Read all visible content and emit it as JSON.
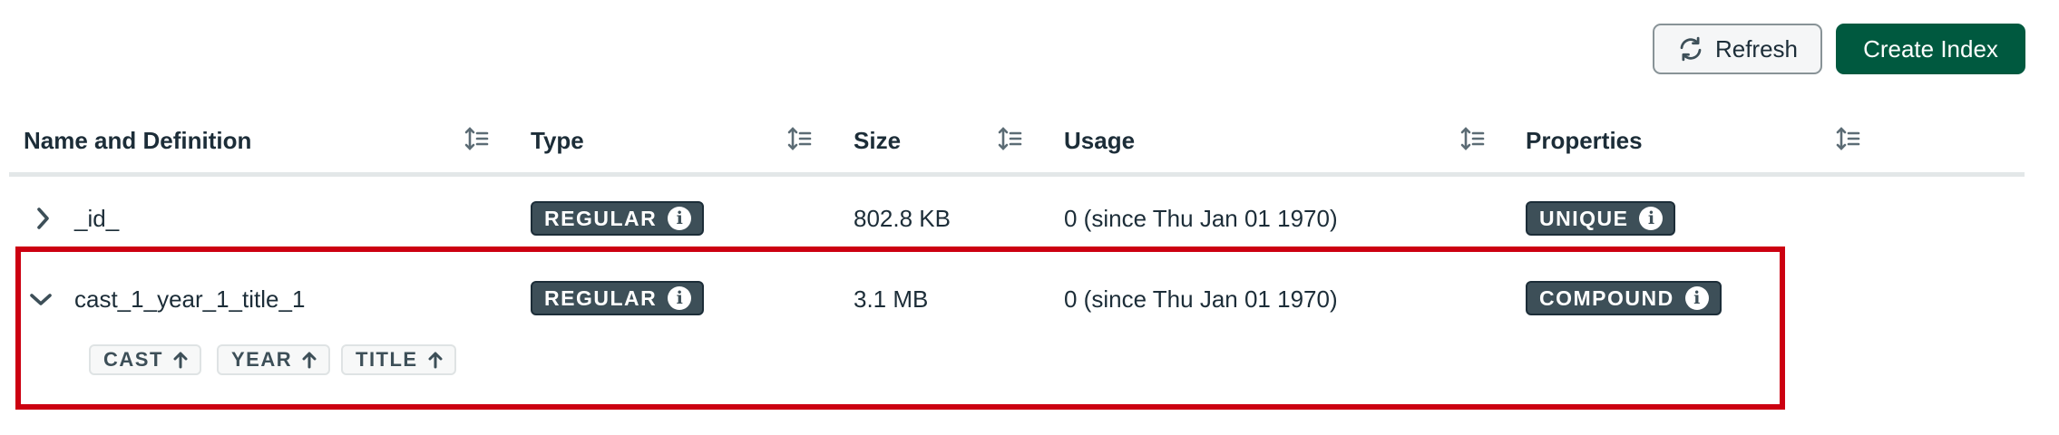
{
  "toolbar": {
    "refresh_label": "Refresh",
    "refresh_icon": "refresh-icon",
    "create_label": "Create Index"
  },
  "table": {
    "columns": [
      "Name and Definition",
      "Type",
      "Size",
      "Usage",
      "Properties"
    ],
    "sort_icon": "sort-icon",
    "rows": [
      {
        "expanded": false,
        "name": "_id_",
        "type": "REGULAR",
        "size": "802.8 KB",
        "usage": "0 (since Thu Jan 01 1970)",
        "property": "UNIQUE"
      },
      {
        "expanded": true,
        "name": "cast_1_year_1_title_1",
        "type": "REGULAR",
        "size": "3.1 MB",
        "usage": "0 (since Thu Jan 01 1970)",
        "property": "COMPOUND",
        "keys": [
          "CAST",
          "YEAR",
          "TITLE"
        ]
      }
    ]
  },
  "colors": {
    "primary_button": "#00593f",
    "badge": "#3d4f58",
    "highlight": "#cc0011"
  }
}
